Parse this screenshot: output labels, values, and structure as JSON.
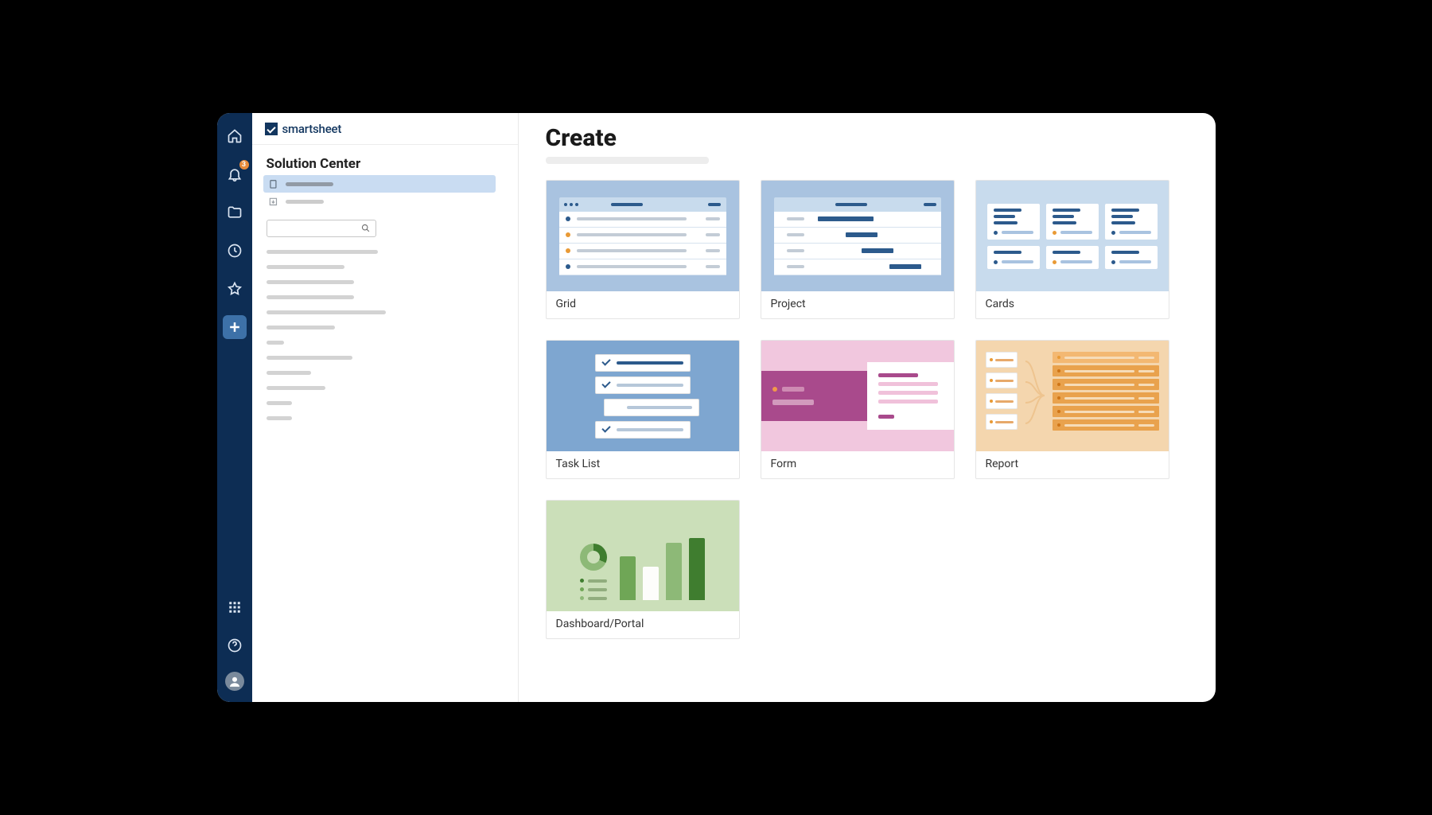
{
  "brand_text": "smartsheet",
  "notifications_badge": "3",
  "panel_title": "Solution Center",
  "main_title": "Create",
  "cards": [
    {
      "label": "Grid"
    },
    {
      "label": "Project"
    },
    {
      "label": "Cards"
    },
    {
      "label": "Task List"
    },
    {
      "label": "Form"
    },
    {
      "label": "Report"
    },
    {
      "label": "Dashboard/Portal"
    }
  ]
}
